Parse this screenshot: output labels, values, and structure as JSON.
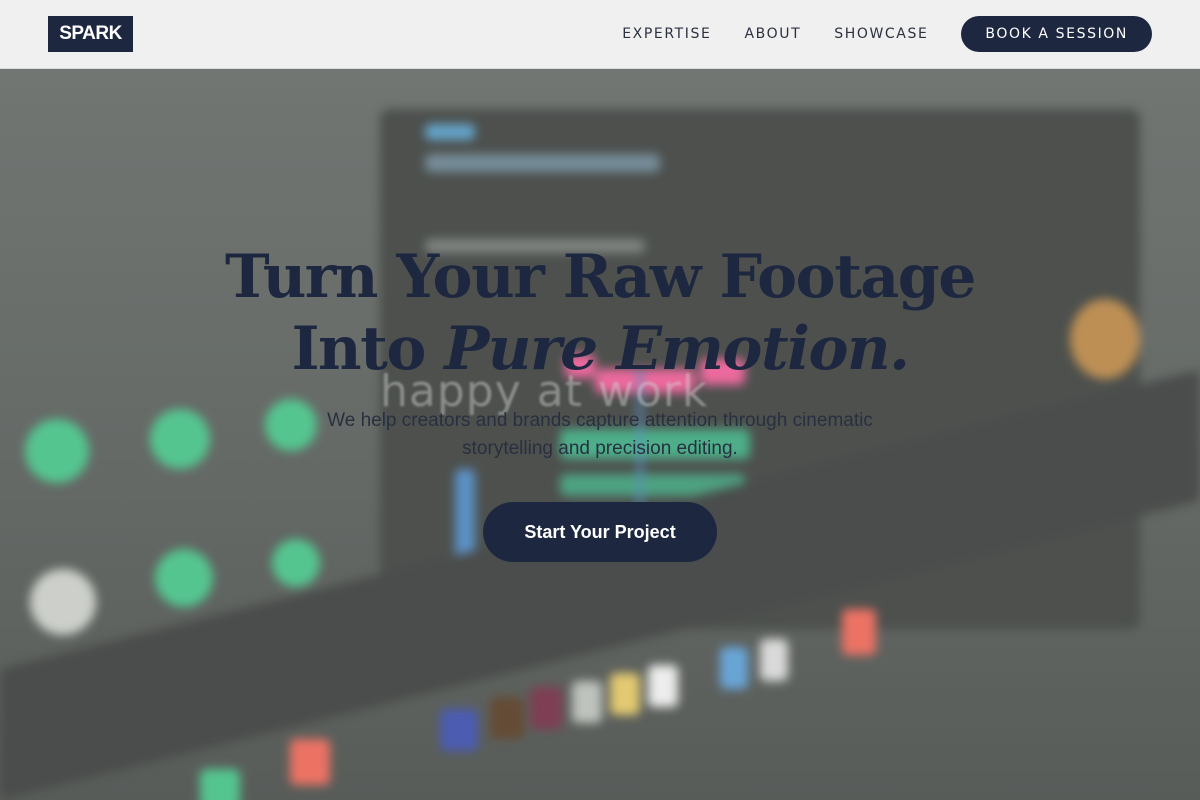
{
  "header": {
    "logo": "SPARK",
    "nav": [
      {
        "label": "EXPERTISE"
      },
      {
        "label": "ABOUT"
      },
      {
        "label": "SHOWCASE"
      }
    ],
    "cta": "BOOK A SESSION"
  },
  "hero": {
    "headline_line1": "Turn Your Raw Footage",
    "headline_line2_plain": "Into ",
    "headline_line2_italic": "Pure Emotion.",
    "subtitle": "We help creators and brands capture attention through cinematic storytelling and precision editing.",
    "cta": "Start Your Project",
    "background_text": "happy at work"
  },
  "colors": {
    "brand_navy": "#1e2740",
    "header_bg": "#f0f0f0",
    "accent_green": "#4fd29a",
    "accent_pink": "#ff5fa0"
  }
}
